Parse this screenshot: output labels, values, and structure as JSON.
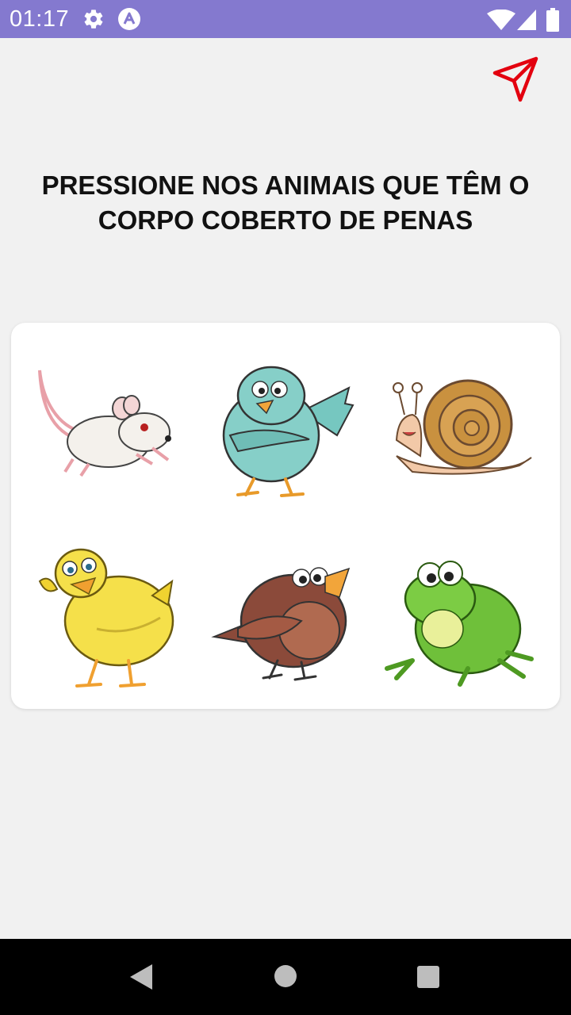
{
  "status_bar": {
    "time": "01:17",
    "icons": [
      "gear-icon",
      "app-a-icon",
      "wifi-icon",
      "signal-icon",
      "battery-icon"
    ],
    "background": "#8479cf"
  },
  "toolbar": {
    "send_icon": "send-icon",
    "send_color": "#e3000f"
  },
  "question": {
    "text": "PRESSIONE NOS ANIMAIS QUE TÊM O CORPO COBERTO DE PENAS"
  },
  "animals": [
    {
      "name": "rato",
      "icon": "mouse-illustration"
    },
    {
      "name": "pássaro azul",
      "icon": "blue-bird-illustration"
    },
    {
      "name": "caracol",
      "icon": "snail-illustration"
    },
    {
      "name": "pintinho",
      "icon": "yellow-chick-illustration"
    },
    {
      "name": "pássaro marrom",
      "icon": "brown-bird-illustration"
    },
    {
      "name": "sapo",
      "icon": "frog-illustration"
    }
  ],
  "nav_bar": {
    "buttons": [
      "back-icon",
      "home-icon",
      "recents-icon"
    ]
  }
}
